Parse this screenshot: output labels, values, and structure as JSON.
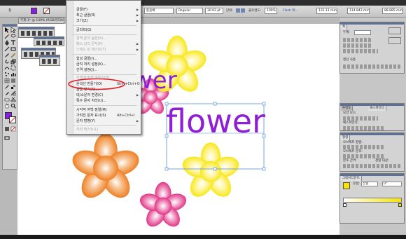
{
  "controlbar": {
    "fill_label": "칠",
    "font_name": "돋움체",
    "font_style": "Regular",
    "font_size": "30.02 pt",
    "paragraph_label": "단락:",
    "opacity_label": "불투명도:",
    "opacity_value": "100%",
    "flash_label": "Flash 텍...",
    "x_value": "131.11 mm",
    "y_value": "114.843 mm",
    "w_value": "88.885 mm"
  },
  "document_tab": {
    "title": "무제-1* @ 149% (RGB/미리보기)"
  },
  "canvas": {
    "flower_text": "flower",
    "partial_text": "wer"
  },
  "menu": {
    "items": [
      {
        "label": "글꼴(F)",
        "shortcut": "",
        "submenu": true,
        "dim": false
      },
      {
        "label": "최근 글꼴(R)",
        "shortcut": "",
        "submenu": true,
        "dim": false
      },
      {
        "label": "크기(Z)",
        "shortcut": "",
        "submenu": true,
        "dim": false
      },
      {
        "label": "글리프(G)",
        "shortcut": "",
        "submenu": false,
        "dim": false
      },
      {
        "label": "영역 문자 옵션(A)...",
        "shortcut": "",
        "submenu": false,
        "dim": true
      },
      {
        "label": "패스 상의 문자(P)",
        "shortcut": "",
        "submenu": true,
        "dim": true
      },
      {
        "label": "스레드 된 텍스트(T)",
        "shortcut": "",
        "submenu": true,
        "dim": true
      },
      {
        "label": "합성 글꼴(I)...",
        "shortcut": "",
        "submenu": false,
        "dim": false
      },
      {
        "label": "금칙 처리 설정(K)...",
        "shortcut": "",
        "submenu": false,
        "dim": false
      },
      {
        "label": "간격 설정(J)...",
        "shortcut": "",
        "submenu": false,
        "dim": false
      },
      {
        "label": "지정에 맞게 맞추기(H)",
        "shortcut": "",
        "submenu": false,
        "dim": true
      },
      {
        "label": "윤곽선 만들기(O)",
        "shortcut": "Shift+Ctrl+O",
        "submenu": false,
        "dim": false
      },
      {
        "label": "글꼴 찾기(N)...",
        "shortcut": "",
        "submenu": false,
        "dim": false
      },
      {
        "label": "대/소문자 변경(C)",
        "shortcut": "",
        "submenu": true,
        "dim": false
      },
      {
        "label": "특수 문자 처리(U)...",
        "shortcut": "",
        "submenu": false,
        "dim": false
      },
      {
        "label": "시각적 여백 정렬(M)",
        "shortcut": "",
        "submenu": false,
        "dim": false
      },
      {
        "label": "가려진 문자 표시(S)",
        "shortcut": "Alt+Ctrl+I",
        "submenu": false,
        "dim": false
      },
      {
        "label": "문자 방향(Y)",
        "shortcut": "",
        "submenu": true,
        "dim": false
      },
      {
        "label": "자리 텍스트(L)",
        "shortcut": "",
        "submenu": false,
        "dim": true
      }
    ]
  },
  "right_panels": {
    "stroke_tab": "획",
    "stroke_weight_label": "두께:",
    "color_guide_tab": "정선 사용",
    "align_tab_1": "칠",
    "transparency_tab": "모양 모드:",
    "pathfinder_label": "패스파인더:",
    "align_tab": "정렬",
    "align_objects_label": "오브젝트 정렬:",
    "distribute_objects_label": "오브젝트 분포:",
    "distribute_spacing_label": "분포 간격:",
    "align_to_label": "정렬 대상:",
    "gradient_tab": "그레이디언트",
    "gradient_type_label": "유형:",
    "gradient_type_value": "선형",
    "gradient_angle_value": "0°"
  },
  "colors": {
    "purple_text": "#8e1fd6",
    "yellow_flower": "#f5e400",
    "orange_flower": "#ee7a14",
    "pink_flower": "#e2297f",
    "selection": "#5a8fd8",
    "highlight_circle": "#e0202a",
    "panel_title": "#5d6f93"
  }
}
